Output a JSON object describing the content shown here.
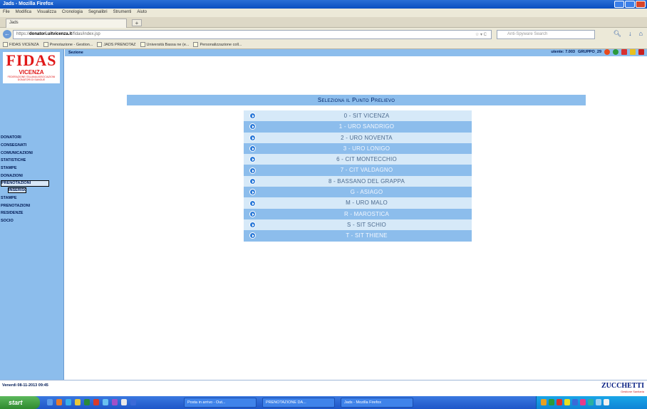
{
  "window": {
    "title": "Jads - Mozilla Firefox"
  },
  "menubar": [
    "File",
    "Modifica",
    "Visualizza",
    "Cronologia",
    "Segnalibri",
    "Strumenti",
    "Aiuto"
  ],
  "tab": {
    "label": "Jads",
    "new_tab": "+"
  },
  "navbar": {
    "back": "←",
    "url_prefix": "https://",
    "url_host": "donatori.uitvicenza.it",
    "url_path": "/fidas/index.jsp",
    "url_tools": "☆ ▾ C",
    "search_placeholder": "Anti-Spyware Search"
  },
  "bookmarks": [
    "FIDAS VICENZA",
    "Prenotazione - Gestion...",
    "JADS PRENOTAZ",
    "Università Bassa ne (e...",
    "Personalizzazione coll..."
  ],
  "sidebar": {
    "logo_main": "FIDAS",
    "logo_sub": "VICENZA",
    "logo_tiny": "FEDERAZIONE ITALIANA ASSOCIAZIONI DONATORI DI SANGUE",
    "menu": [
      {
        "label": "DONATORI",
        "style": ""
      },
      {
        "label": "CONSEGNATI",
        "style": ""
      },
      {
        "label": "COMUNICAZIONI",
        "style": ""
      },
      {
        "label": "STATISTICHE",
        "style": ""
      },
      {
        "label": "STAMPE",
        "style": ""
      },
      {
        "label": "DONAZIONI",
        "style": ""
      },
      {
        "label": "PRENOTAZIONI",
        "style": "boxed"
      },
      {
        "label": "INSERISCI",
        "style": "sub"
      },
      {
        "label": "STAMPE",
        "style": ""
      },
      {
        "label": "PRENOTAZIONI",
        "style": ""
      },
      {
        "label": "RESIDENZE",
        "style": ""
      },
      {
        "label": "SOCIO",
        "style": ""
      }
    ]
  },
  "header": {
    "left_label": "Sezione",
    "user_label": "utente: 7.003",
    "group_label": "GRUPPO_29"
  },
  "content": {
    "title": "Seleziona il Punto Prelievo",
    "points": [
      "0 - SIT VICENZA",
      "1 - URO SANDRIGO",
      "2 - URO NOVENTA",
      "3 - URO LONIGO",
      "6 - CIT MONTECCHIO",
      "7 - CIT VALDAGNO",
      "8 - BASSANO DEL GRAPPA",
      "G - ASIAGO",
      "M - URO MALO",
      "R - MAROSTICA",
      "S - SIT SCHIO",
      "T - SIT THIENE"
    ]
  },
  "footer": {
    "date": "Venerdì 08-11-2013 09:45",
    "brand": "ZUCCHETTI",
    "tagline": "Gestione Sanitaria"
  },
  "taskbar": {
    "start": "start",
    "tasks": [
      "Posta in arrivo - Out...",
      "PRENOTAZIONE DA...",
      "Jads - Mozilla Firefox"
    ]
  }
}
